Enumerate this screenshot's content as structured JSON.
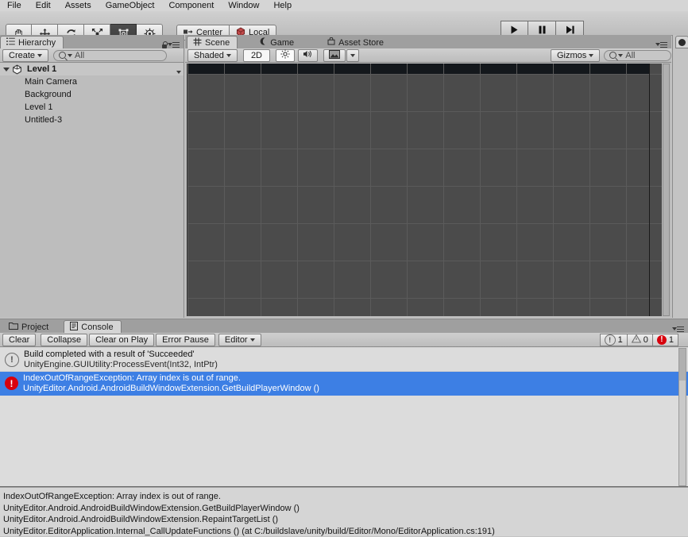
{
  "menubar": {
    "items": [
      "File",
      "Edit",
      "Assets",
      "GameObject",
      "Component",
      "Window",
      "Help"
    ]
  },
  "toolbar": {
    "tools": [
      {
        "name": "hand-tool",
        "icon": "hand-icon",
        "active": false
      },
      {
        "name": "move-tool",
        "icon": "move-icon",
        "active": false
      },
      {
        "name": "rotate-tool",
        "icon": "rotate-icon",
        "active": false
      },
      {
        "name": "scale-tool",
        "icon": "scale-icon",
        "active": false
      },
      {
        "name": "rect-tool",
        "icon": "rect-transform-icon",
        "active": true
      },
      {
        "name": "transform-tool",
        "icon": "transform-icon",
        "active": false
      }
    ],
    "pivot_label": "Center",
    "handle_label": "Local",
    "play_label": "play-icon",
    "pause_label": "pause-icon",
    "step_label": "step-icon"
  },
  "hierarchy": {
    "tab_label": "Hierarchy",
    "create_label": "Create",
    "search_value": "All",
    "scene_name": "Level 1",
    "objects": [
      "Main Camera",
      "Background",
      "Level 1",
      "Untitled-3"
    ]
  },
  "scene": {
    "tabs": [
      {
        "label": "Scene",
        "icon": "scene-grid-icon",
        "active": true
      },
      {
        "label": "Game",
        "icon": "game-icon",
        "active": false
      },
      {
        "label": "Asset Store",
        "icon": "store-icon",
        "active": false
      }
    ],
    "shading_label": "Shaded",
    "mode_2d_label": "2D",
    "lighting_icon": "sun-icon",
    "audio_icon": "speaker-icon",
    "fx_icon": "image-icon",
    "gizmos_label": "Gizmos",
    "search_value": "All"
  },
  "console": {
    "tabs": [
      {
        "label": "Project",
        "icon": "folder-icon",
        "active": false
      },
      {
        "label": "Console",
        "icon": "console-icon",
        "active": true
      }
    ],
    "buttons": [
      "Clear",
      "Collapse",
      "Clear on Play",
      "Error Pause"
    ],
    "editor_label": "Editor",
    "counters": [
      {
        "name": "info-count",
        "icon": "info-icon",
        "value": "1"
      },
      {
        "name": "warning-count",
        "icon": "warning-icon",
        "value": "0"
      },
      {
        "name": "error-count",
        "icon": "error-icon",
        "value": "1"
      }
    ],
    "entries": [
      {
        "type": "info",
        "line1": "Build completed with a result of 'Succeeded'",
        "line2": "UnityEngine.GUIUtility:ProcessEvent(Int32, IntPtr)",
        "selected": false
      },
      {
        "type": "error",
        "line1": "IndexOutOfRangeException: Array index is out of range.",
        "line2": "UnityEditor.Android.AndroidBuildWindowExtension.GetBuildPlayerWindow ()",
        "selected": true
      }
    ],
    "stacktrace": [
      "IndexOutOfRangeException: Array index is out of range.",
      "UnityEditor.Android.AndroidBuildWindowExtension.GetBuildPlayerWindow ()",
      "UnityEditor.Android.AndroidBuildWindowExtension.RepaintTargetList ()",
      "UnityEditor.EditorApplication.Internal_CallUpdateFunctions () (at C:/buildslave/unity/build/Editor/Mono/EditorApplication.cs:191)"
    ]
  },
  "colors": {
    "selection_blue": "#3d7fe4",
    "error_red": "#d8000c",
    "scene_bg": "#4b4b4b",
    "chrome": "#c3c3c3"
  }
}
